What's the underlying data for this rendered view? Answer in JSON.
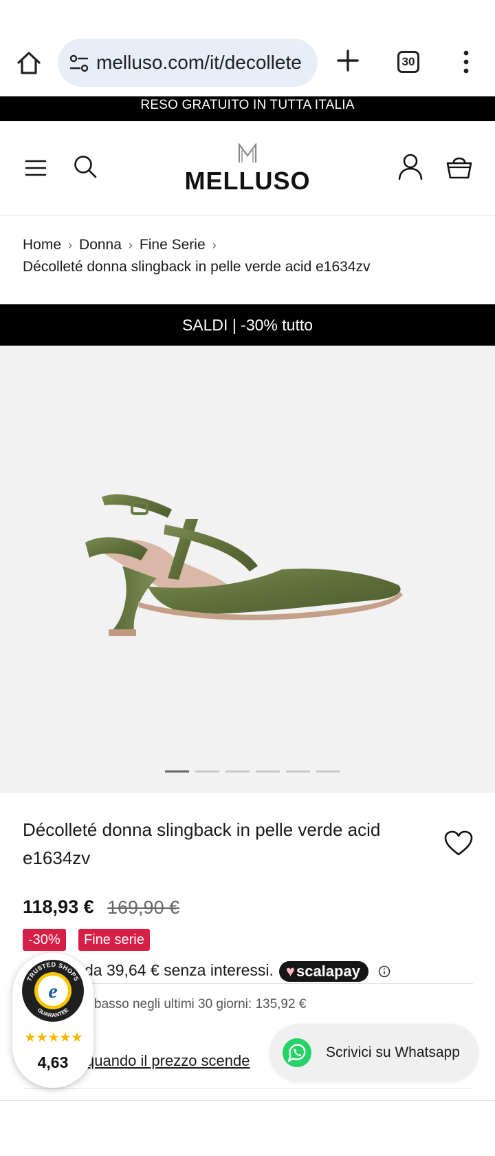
{
  "browser": {
    "url": "melluso.com/it/decollete",
    "tab_count": "30",
    "icons": [
      "home-icon",
      "site-settings-icon",
      "new-tab-icon",
      "tab-switcher-icon",
      "more-options-icon"
    ]
  },
  "announcement": {
    "text": "RESO GRATUITO IN TUTTA ITALIA"
  },
  "header": {
    "logo": "MELLUSO",
    "icons": [
      "menu-icon",
      "search-icon",
      "account-icon",
      "cart-icon"
    ]
  },
  "breadcrumb": {
    "items": [
      "Home",
      "Donna",
      "Fine Serie"
    ],
    "current": "Décolleté donna slingback in pelle verde acid e1634zv"
  },
  "sale_banner": {
    "text": "SALDI | -30% tutto"
  },
  "gallery": {
    "slide_count": 6,
    "active_index": 0
  },
  "product": {
    "title": "Décolleté donna slingback in pelle verde acid e1634zv",
    "price": "118,93 €",
    "old_price": "169,90 €",
    "badges": {
      "discount": "-30%",
      "fine_serie": "Fine serie"
    },
    "installments_text": "da 39,64 € senza interessi.",
    "scalapay_label": "scalapay",
    "lowest_price_text": "basso negli ultimi 30 giorni: 135,92 €",
    "price_alert_text": "quando il prezzo scende"
  },
  "trusted_shops": {
    "seal_text": "TRUSTED SHOPS GUARANTEE",
    "stars": "★★★★★",
    "rating": "4,63"
  },
  "whatsapp": {
    "label": "Scrivici su Whatsapp"
  },
  "colors": {
    "accent_badge": "#d61f47",
    "announcement_bg": "#000000",
    "whatsapp_green": "#25d366",
    "url_bar_bg": "#e8eef7"
  }
}
